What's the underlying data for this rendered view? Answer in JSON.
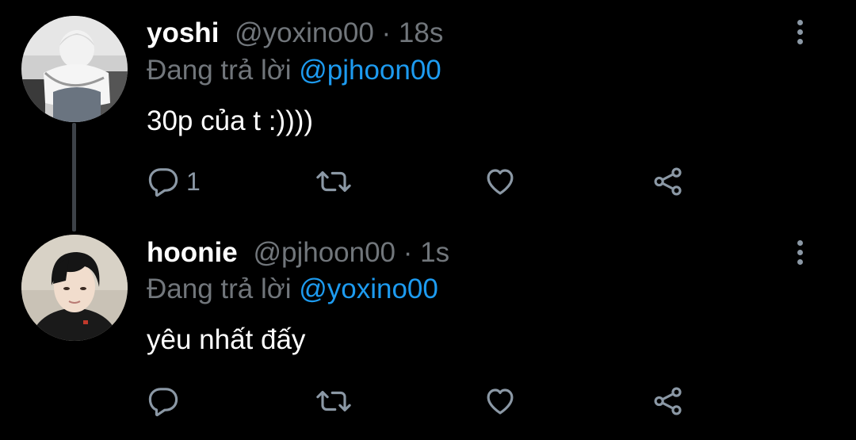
{
  "tweets": [
    {
      "display_name": "yoshi",
      "handle": "@yoxino00",
      "separator": "·",
      "time": "18s",
      "reply_prefix": "Đang trả lời",
      "reply_to": "@pjhoon00",
      "text": "30p của t :))))",
      "reply_count": "1",
      "avatar_icon": "avatar-bw-photo"
    },
    {
      "display_name": "hoonie",
      "handle": "@pjhoon00",
      "separator": "·",
      "time": "1s",
      "reply_prefix": "Đang trả lời",
      "reply_to": "@yoxino00",
      "text": "yêu nhất đấy",
      "reply_count": "",
      "avatar_icon": "avatar-photo"
    }
  ],
  "colors": {
    "background": "#000000",
    "primary_text": "#ffffff",
    "secondary_text": "#71767b",
    "accent": "#1d9bf0",
    "icon": "#8b98a5",
    "thread_line": "#3d4248"
  },
  "icons": [
    "reply-icon",
    "retweet-icon",
    "like-icon",
    "share-icon",
    "more-options-icon"
  ]
}
